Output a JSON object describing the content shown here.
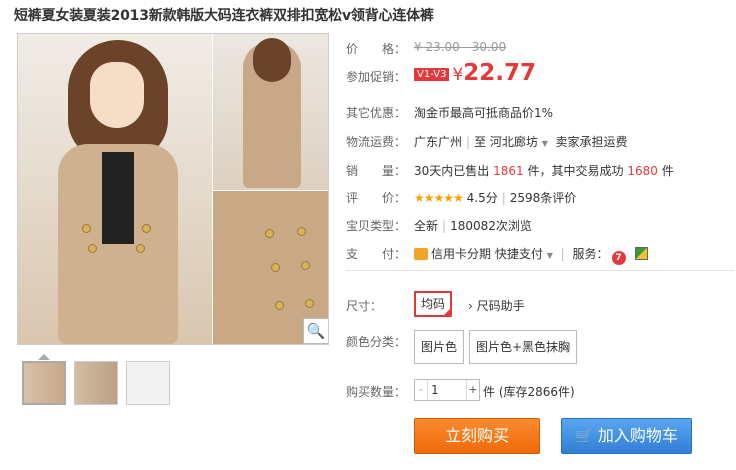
{
  "title": "短裤夏女装夏装2013新款韩版大码连衣裤双排扣宽松v领背心连体裤",
  "price": {
    "label": "价　　格：",
    "original": "¥ 23.00 - 30.00"
  },
  "promo": {
    "label": "参加促销：",
    "badge": "V1-V3",
    "currency": "¥",
    "value": "22.77"
  },
  "other": {
    "label": "其它优惠：",
    "text": "淘金币最高可抵商品价1%"
  },
  "shipping": {
    "label": "物流运费：",
    "from": "广东广州",
    "sep": "|",
    "to_prefix": "至",
    "to": "河北廊坊",
    "note": "卖家承担运费"
  },
  "sales": {
    "label": "销　　量：",
    "prefix": "30天内已售出",
    "sold": "1861",
    "mid": "件，其中交易成功",
    "success": "1680",
    "suffix": "件"
  },
  "rating": {
    "label": "评　　价：",
    "stars": "★★★★★",
    "score": "4.5分",
    "sep": "|",
    "reviews": "2598条评价"
  },
  "type": {
    "label": "宝贝类型：",
    "condition": "全新",
    "sep": "|",
    "views": "180082次浏览"
  },
  "payment": {
    "label": "支　　付：",
    "credit": "信用卡分期",
    "quick": "快捷支付",
    "service_label": "服务：",
    "tm_icon": "7"
  },
  "size": {
    "label": "尺寸：",
    "selected": "均码",
    "helper": "尺码助手"
  },
  "color": {
    "label": "颜色分类：",
    "options": [
      "图片色",
      "图片色+黑色抹胸"
    ]
  },
  "quantity": {
    "label": "购买数量：",
    "minus": "-",
    "value": "1",
    "plus": "+",
    "stock": "件 (库存2866件)"
  },
  "buttons": {
    "buy": "立刻购买",
    "cart": "加入购物车"
  },
  "icons": {
    "zoom": "magnifier-icon",
    "cart": "cart-icon",
    "card": "credit-card-icon"
  },
  "colors": {
    "accent": "#e4393c",
    "buy": "#f47a1f",
    "cart": "#3d8ee3"
  }
}
